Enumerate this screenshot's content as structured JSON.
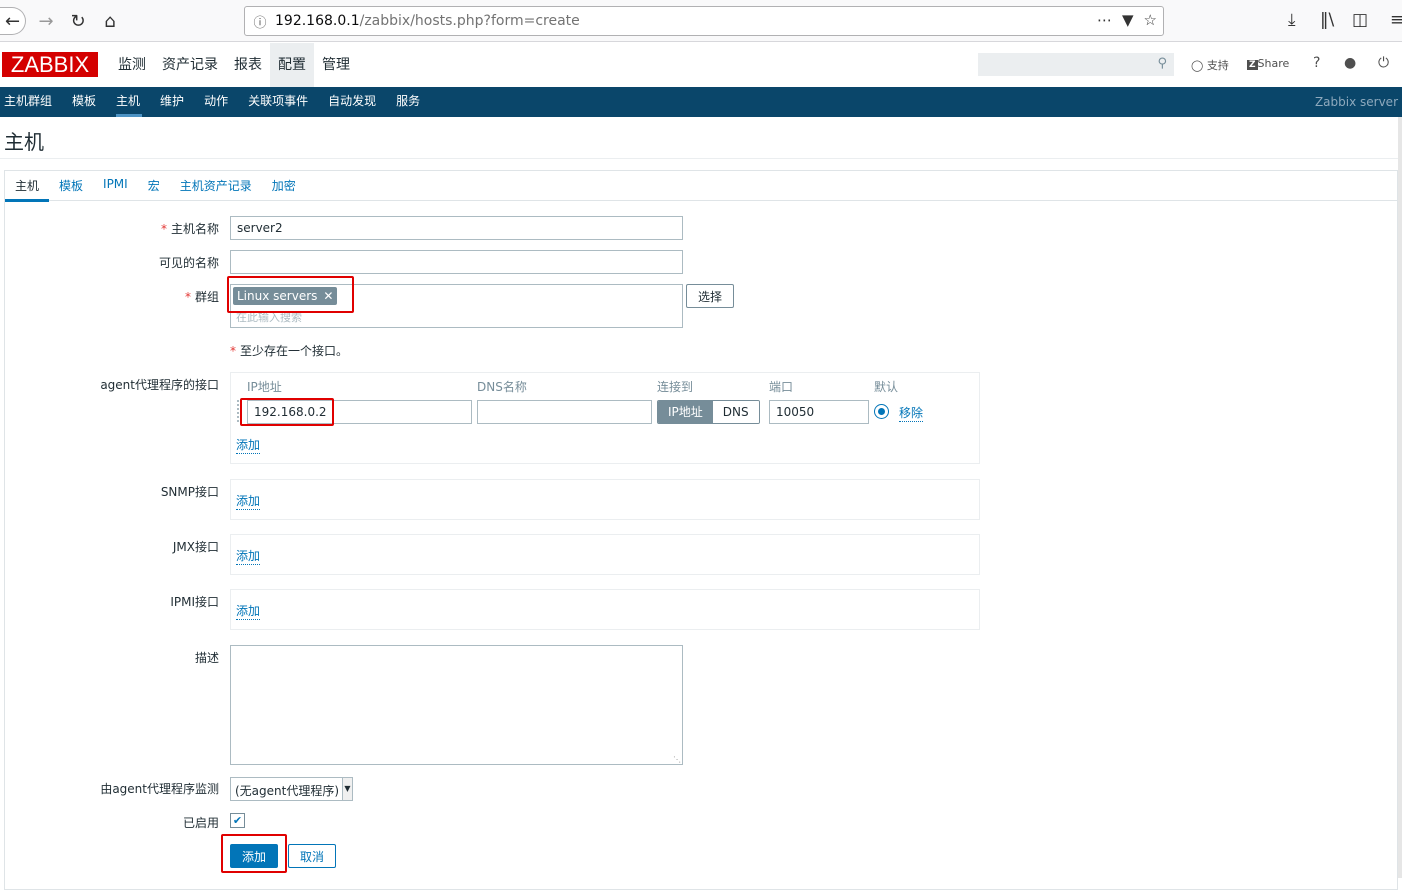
{
  "browser": {
    "url_host": "192.168.0.1",
    "url_path": "/zabbix/hosts.php?form=create"
  },
  "header": {
    "logo": "ZABBIX",
    "menu": [
      "监测",
      "资产记录",
      "报表",
      "配置",
      "管理"
    ],
    "support": "支持",
    "share": "Share",
    "help": "?"
  },
  "submenu": {
    "items": [
      "主机群组",
      "模板",
      "主机",
      "维护",
      "动作",
      "关联项事件",
      "自动发现",
      "服务"
    ],
    "server": "Zabbix server"
  },
  "page": {
    "title": "主机"
  },
  "tabs": [
    "主机",
    "模板",
    "IPMI",
    "宏",
    "主机资产记录",
    "加密"
  ],
  "form": {
    "host_name_label": "主机名称",
    "host_name_value": "server2",
    "visible_name_label": "可见的名称",
    "visible_name_value": "",
    "groups_label": "群组",
    "group_tag": "Linux servers",
    "groups_placeholder": "在此输入搜索",
    "select_button": "选择",
    "interface_hint": "至少存在一个接口。",
    "agent_label": "agent代理程序的接口",
    "iface_headers": {
      "ip": "IP地址",
      "dns": "DNS名称",
      "connect": "连接到",
      "port": "端口",
      "default": "默认"
    },
    "agent_ip": "192.168.0.2",
    "agent_dns": "",
    "connect_ip": "IP地址",
    "connect_dns": "DNS",
    "agent_port": "10050",
    "remove": "移除",
    "add": "添加",
    "snmp_label": "SNMP接口",
    "jmx_label": "JMX接口",
    "ipmi_label": "IPMI接口",
    "description_label": "描述",
    "proxy_label": "由agent代理程序监测",
    "proxy_value": "(无agent代理程序)",
    "enabled_label": "已启用",
    "add_button": "添加",
    "cancel_button": "取消"
  }
}
